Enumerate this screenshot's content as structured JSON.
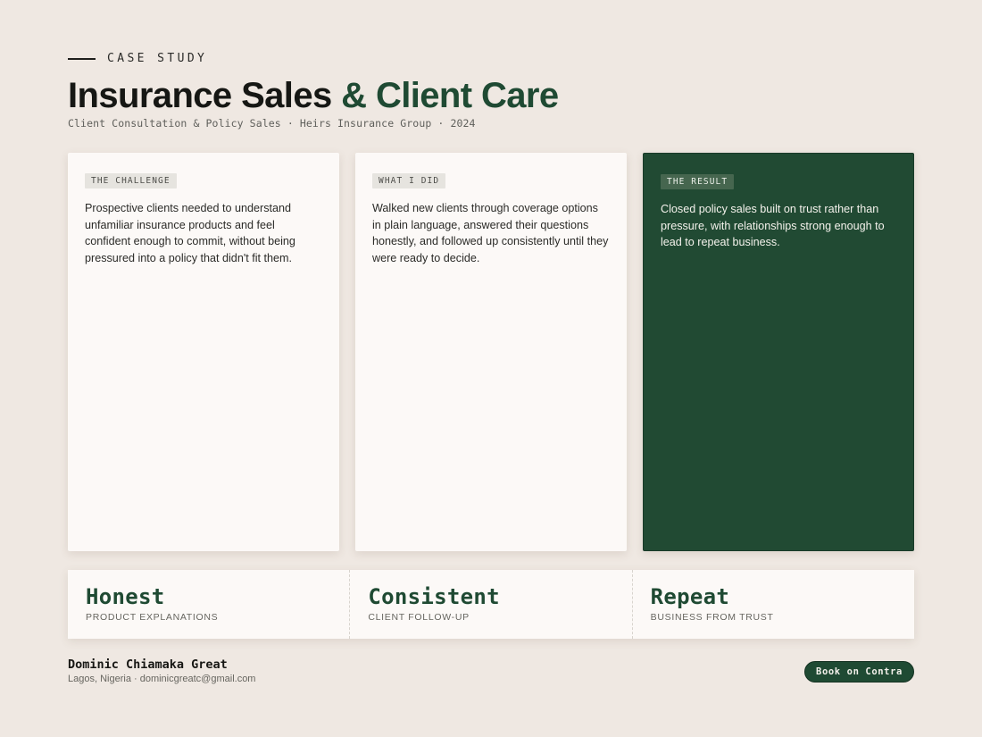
{
  "header": {
    "eyebrow": "CASE STUDY",
    "title_part1": "Insurance Sales",
    "title_part2": "& Client Care",
    "subtitle": "Client Consultation & Policy Sales · Heirs Insurance Group · 2024"
  },
  "cards": [
    {
      "tag": "THE CHALLENGE",
      "body": "Prospective clients needed to understand unfamiliar insurance products and feel confident enough to commit, without being pressured into a policy that didn't fit them."
    },
    {
      "tag": "WHAT I DID",
      "body": "Walked new clients through coverage options in plain language, answered their questions honestly, and followed up consistently until they were ready to decide."
    },
    {
      "tag": "THE RESULT",
      "body": "Closed policy sales built on trust rather than pressure, with relationships strong enough to lead to repeat business."
    }
  ],
  "stats": [
    {
      "value": "Honest",
      "label": "PRODUCT EXPLANATIONS"
    },
    {
      "value": "Consistent",
      "label": "CLIENT FOLLOW-UP"
    },
    {
      "value": "Repeat",
      "label": "BUSINESS FROM TRUST"
    }
  ],
  "footer": {
    "name": "Dominic Chiamaka Great",
    "meta": "Lagos, Nigeria · dominicgreatc@gmail.com",
    "cta_label": "Book on Contra"
  },
  "colors": {
    "background": "#efe8e2",
    "accent_green": "#1f4a33",
    "card": "#fcf9f7",
    "text_dark": "#161714"
  }
}
